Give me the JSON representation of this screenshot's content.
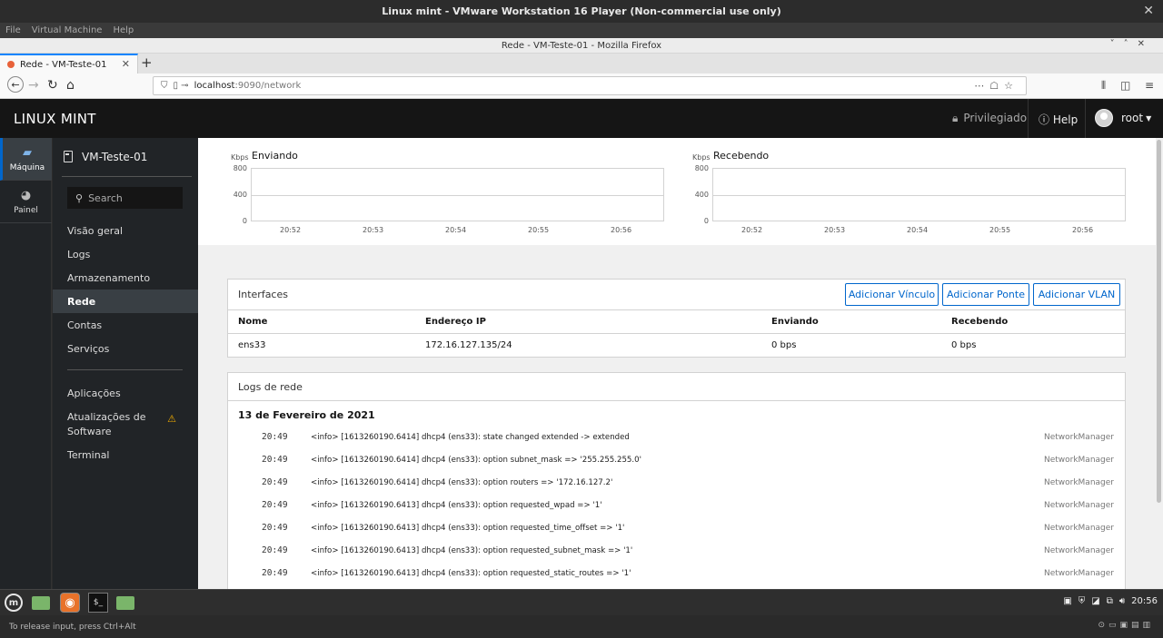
{
  "vmware": {
    "title": "Linux mint - VMware Workstation 16 Player (Non-commercial use only)",
    "menu": [
      "File",
      "Virtual Machine",
      "Help"
    ],
    "status_text": "To release input, press Ctrl+Alt"
  },
  "firefox": {
    "window_title": "Rede - VM-Teste-01 - Mozilla Firefox",
    "tab_title": "Rede - VM-Teste-01",
    "url_host": "localhost",
    "url_path": ":9090/network"
  },
  "header": {
    "brand": "LINUX MINT",
    "privileged": "Privilegiado",
    "help": "Help",
    "user": "root"
  },
  "leftnav": [
    {
      "label": "Máquina"
    },
    {
      "label": "Painel"
    }
  ],
  "sidebar": {
    "host": "VM-Teste-01",
    "search_placeholder": "Search",
    "items": [
      "Visão geral",
      "Logs",
      "Armazenamento",
      "Rede",
      "Contas",
      "Serviços"
    ],
    "items2": [
      "Aplicações",
      "Atualizações de Software",
      "Terminal"
    ]
  },
  "graphs": {
    "unit": "Kbps",
    "sending_title": "Enviando",
    "receiving_title": "Recebendo",
    "y_ticks": [
      "800",
      "400",
      "0"
    ],
    "x_ticks": [
      "20:52",
      "20:53",
      "20:54",
      "20:55",
      "20:56"
    ]
  },
  "interfaces": {
    "title": "Interfaces",
    "buttons": [
      "Adicionar Vínculo",
      "Adicionar Ponte",
      "Adicionar VLAN"
    ],
    "columns": [
      "Nome",
      "Endereço IP",
      "Enviando",
      "Recebendo"
    ],
    "rows": [
      {
        "name": "ens33",
        "ip": "172.16.127.135/24",
        "sending": "0 bps",
        "receiving": "0 bps"
      }
    ]
  },
  "logs": {
    "title": "Logs de rede",
    "date": "13 de Fevereiro de 2021",
    "entries": [
      {
        "time": "20:49",
        "msg": "<info> [1613260190.6414] dhcp4 (ens33): state changed extended -> extended",
        "src": "NetworkManager"
      },
      {
        "time": "20:49",
        "msg": "<info> [1613260190.6414] dhcp4 (ens33): option subnet_mask => '255.255.255.0'",
        "src": "NetworkManager"
      },
      {
        "time": "20:49",
        "msg": "<info> [1613260190.6414] dhcp4 (ens33): option routers => '172.16.127.2'",
        "src": "NetworkManager"
      },
      {
        "time": "20:49",
        "msg": "<info> [1613260190.6413] dhcp4 (ens33): option requested_wpad => '1'",
        "src": "NetworkManager"
      },
      {
        "time": "20:49",
        "msg": "<info> [1613260190.6413] dhcp4 (ens33): option requested_time_offset => '1'",
        "src": "NetworkManager"
      },
      {
        "time": "20:49",
        "msg": "<info> [1613260190.6413] dhcp4 (ens33): option requested_subnet_mask => '1'",
        "src": "NetworkManager"
      },
      {
        "time": "20:49",
        "msg": "<info> [1613260190.6413] dhcp4 (ens33): option requested_static_routes => '1'",
        "src": "NetworkManager"
      }
    ]
  },
  "taskbar": {
    "clock": "20:56"
  }
}
